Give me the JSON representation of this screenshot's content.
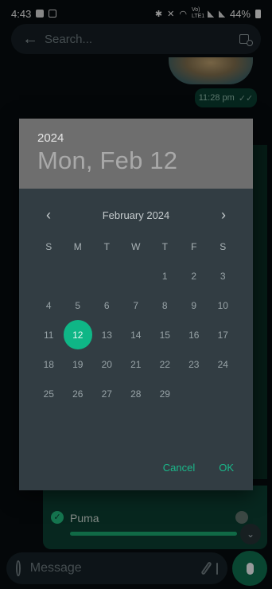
{
  "status_bar": {
    "time": "4:43",
    "net_label": "Vo) LTE1",
    "battery": "44%"
  },
  "search": {
    "placeholder": "Search..."
  },
  "chat": {
    "timestamp": "11:28 pm",
    "read_receipt": "✓✓",
    "poll_option": "Puma",
    "poll_check": "✓"
  },
  "composer": {
    "placeholder": "Message"
  },
  "date_picker": {
    "year": "2024",
    "selected_date": "Mon, Feb 12",
    "month_label": "February 2024",
    "prev": "‹",
    "next": "›",
    "weekdays": [
      "S",
      "M",
      "T",
      "W",
      "T",
      "F",
      "S"
    ],
    "weeks": [
      [
        "",
        "",
        "",
        "",
        "1",
        "2",
        "3"
      ],
      [
        "4",
        "5",
        "6",
        "7",
        "8",
        "9",
        "10"
      ],
      [
        "11",
        "12",
        "13",
        "14",
        "15",
        "16",
        "17"
      ],
      [
        "18",
        "19",
        "20",
        "21",
        "22",
        "23",
        "24"
      ],
      [
        "25",
        "26",
        "27",
        "28",
        "29",
        "",
        ""
      ]
    ],
    "selected_day": "12",
    "cancel_label": "Cancel",
    "ok_label": "OK"
  },
  "colors": {
    "accent": "#0fb686",
    "dialog_bg": "#323d43",
    "header_bg": "#6e6e6e"
  }
}
